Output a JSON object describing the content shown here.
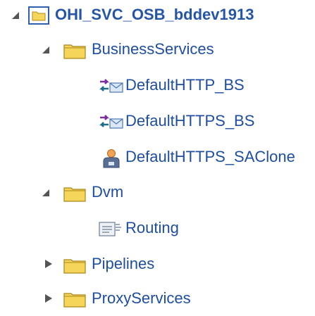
{
  "tree": {
    "root": {
      "label": "OHI_SVC_OSB_bddev1913",
      "expanded": true,
      "icon": "project-folder-icon"
    },
    "business_services": {
      "label": "BusinessServices",
      "expanded": true,
      "icon": "folder-icon",
      "items": [
        {
          "label": "DefaultHTTP_BS",
          "icon": "business-service-icon"
        },
        {
          "label": "DefaultHTTPS_BS",
          "icon": "business-service-icon"
        },
        {
          "label": "DefaultHTTPS_SAClone",
          "icon": "user-service-icon"
        }
      ]
    },
    "dvm": {
      "label": "Dvm",
      "expanded": true,
      "icon": "folder-icon",
      "items": [
        {
          "label": "Routing",
          "icon": "dvm-document-icon"
        }
      ]
    },
    "pipelines": {
      "label": "Pipelines",
      "expanded": false,
      "icon": "folder-icon"
    },
    "proxy_services": {
      "label": "ProxyServices",
      "expanded": false,
      "icon": "folder-icon"
    }
  },
  "colors": {
    "label_text": "#1f4ea0",
    "folder_yellow": "#f5d55a",
    "root_box_blue": "#2f5fb3"
  }
}
